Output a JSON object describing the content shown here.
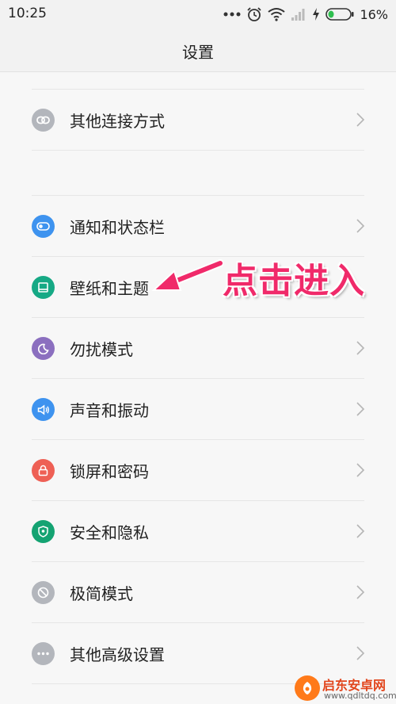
{
  "status_bar": {
    "time": "10:25",
    "battery_percent": "16%",
    "icons": [
      "more-dots-icon",
      "alarm-icon",
      "wifi-icon",
      "signal-icon",
      "charging-icon",
      "battery-icon"
    ]
  },
  "header": {
    "title": "设置"
  },
  "settings": {
    "items": [
      {
        "label": "其他连接方式",
        "icon": "link-icon",
        "color": "#b3b6bc"
      },
      {
        "label": "通知和状态栏",
        "icon": "toggle-icon",
        "color": "#3e93ef"
      },
      {
        "label": "壁纸和主题",
        "icon": "wallpaper-icon",
        "color": "#16a985"
      },
      {
        "label": "勿扰模式",
        "icon": "moon-icon",
        "color": "#8b6fbf"
      },
      {
        "label": "声音和振动",
        "icon": "speaker-icon",
        "color": "#3e93ef"
      },
      {
        "label": "锁屏和密码",
        "icon": "lock-icon",
        "color": "#ee6055"
      },
      {
        "label": "安全和隐私",
        "icon": "shield-icon",
        "color": "#14a372"
      },
      {
        "label": "极简模式",
        "icon": "minimal-mode-icon",
        "color": "#b3b6bc"
      },
      {
        "label": "其他高级设置",
        "icon": "more-icon",
        "color": "#b3b6bc"
      }
    ]
  },
  "annotation": {
    "text": "点击进入",
    "color": "#f02a6a"
  },
  "watermark": {
    "title": "启东安卓网",
    "url": "www.qdltdq.com",
    "color": "#ff7a1a"
  }
}
